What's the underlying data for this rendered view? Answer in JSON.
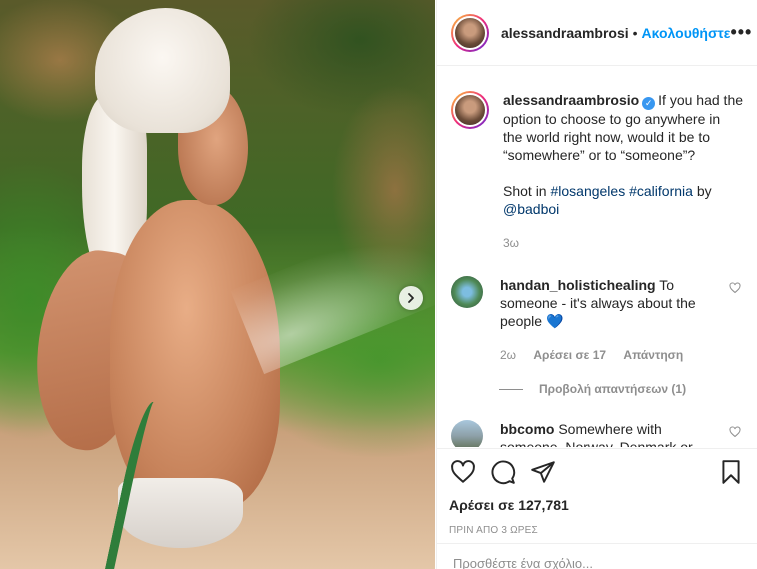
{
  "post": {
    "username": "alessandraambrosi",
    "follow_label": "Ακολουθήστε",
    "dot": "•",
    "more": "•••"
  },
  "caption": {
    "username": "alessandraambrosio",
    "text_line1": "If you had the option to choose to go anywhere in the world right now, would it be to “somewhere” or to “someone”?",
    "shot_in": "Shot in",
    "hashtag1": "#losangeles",
    "hashtag2": "#california",
    "by": "by",
    "mention": "@badboi",
    "age": "3ω"
  },
  "comments": [
    {
      "username": "handan_holistichealing",
      "text": "To someone - it's always about the people",
      "emoji": "💙",
      "age": "2ω",
      "likes": "Αρέσει σε 17",
      "reply": "Απάντηση",
      "view_replies": "Προβολή απαντήσεων (1)"
    },
    {
      "username": "bbcomo",
      "text": "Somewhere with someone. Norway, Denmark or"
    }
  ],
  "actions": {
    "likes_label": "Αρέσει σε 127,781",
    "timestamp": "ΠΡΙΝ ΑΠΟ 3 ΩΡΕΣ"
  },
  "add_comment": {
    "placeholder": "Προσθέστε ένα σχόλιο..."
  },
  "icons": [
    "next-arrow-icon",
    "heart-icon",
    "comment-icon",
    "share-icon",
    "bookmark-icon",
    "verified-badge-icon"
  ]
}
